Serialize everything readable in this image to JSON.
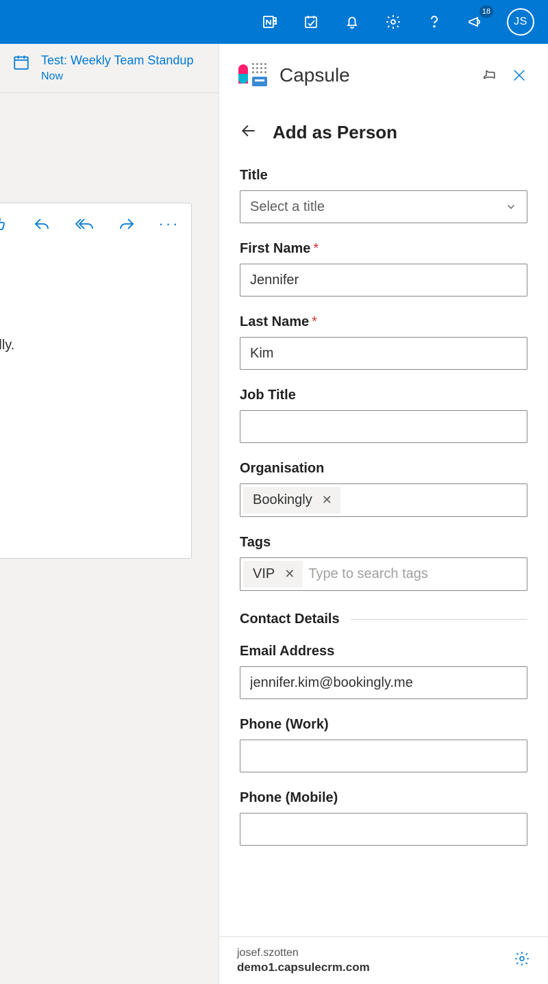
{
  "header": {
    "notification_count": "18",
    "avatar_initials": "JS"
  },
  "outlook": {
    "event_title": "Test: Weekly Team Standup",
    "event_time": "Now",
    "mail_fragment": "onally."
  },
  "capsule": {
    "app_name": "Capsule",
    "page_title": "Add as Person",
    "footer_user": "josef.szotten",
    "footer_domain": "demo1.capsulecrm.com"
  },
  "form": {
    "title": {
      "label": "Title",
      "placeholder": "Select a title",
      "value": ""
    },
    "first_name": {
      "label": "First Name",
      "value": "Jennifer"
    },
    "last_name": {
      "label": "Last Name",
      "value": "Kim"
    },
    "job_title": {
      "label": "Job Title",
      "value": ""
    },
    "organisation": {
      "label": "Organisation",
      "chip": "Bookingly"
    },
    "tags": {
      "label": "Tags",
      "chip": "VIP",
      "placeholder": "Type to search tags"
    },
    "section_contact": "Contact Details",
    "email": {
      "label": "Email Address",
      "value": "jennifer.kim@bookingly.me"
    },
    "phone_work": {
      "label": "Phone (Work)",
      "value": ""
    },
    "phone_mobile": {
      "label": "Phone (Mobile)",
      "value": ""
    }
  }
}
